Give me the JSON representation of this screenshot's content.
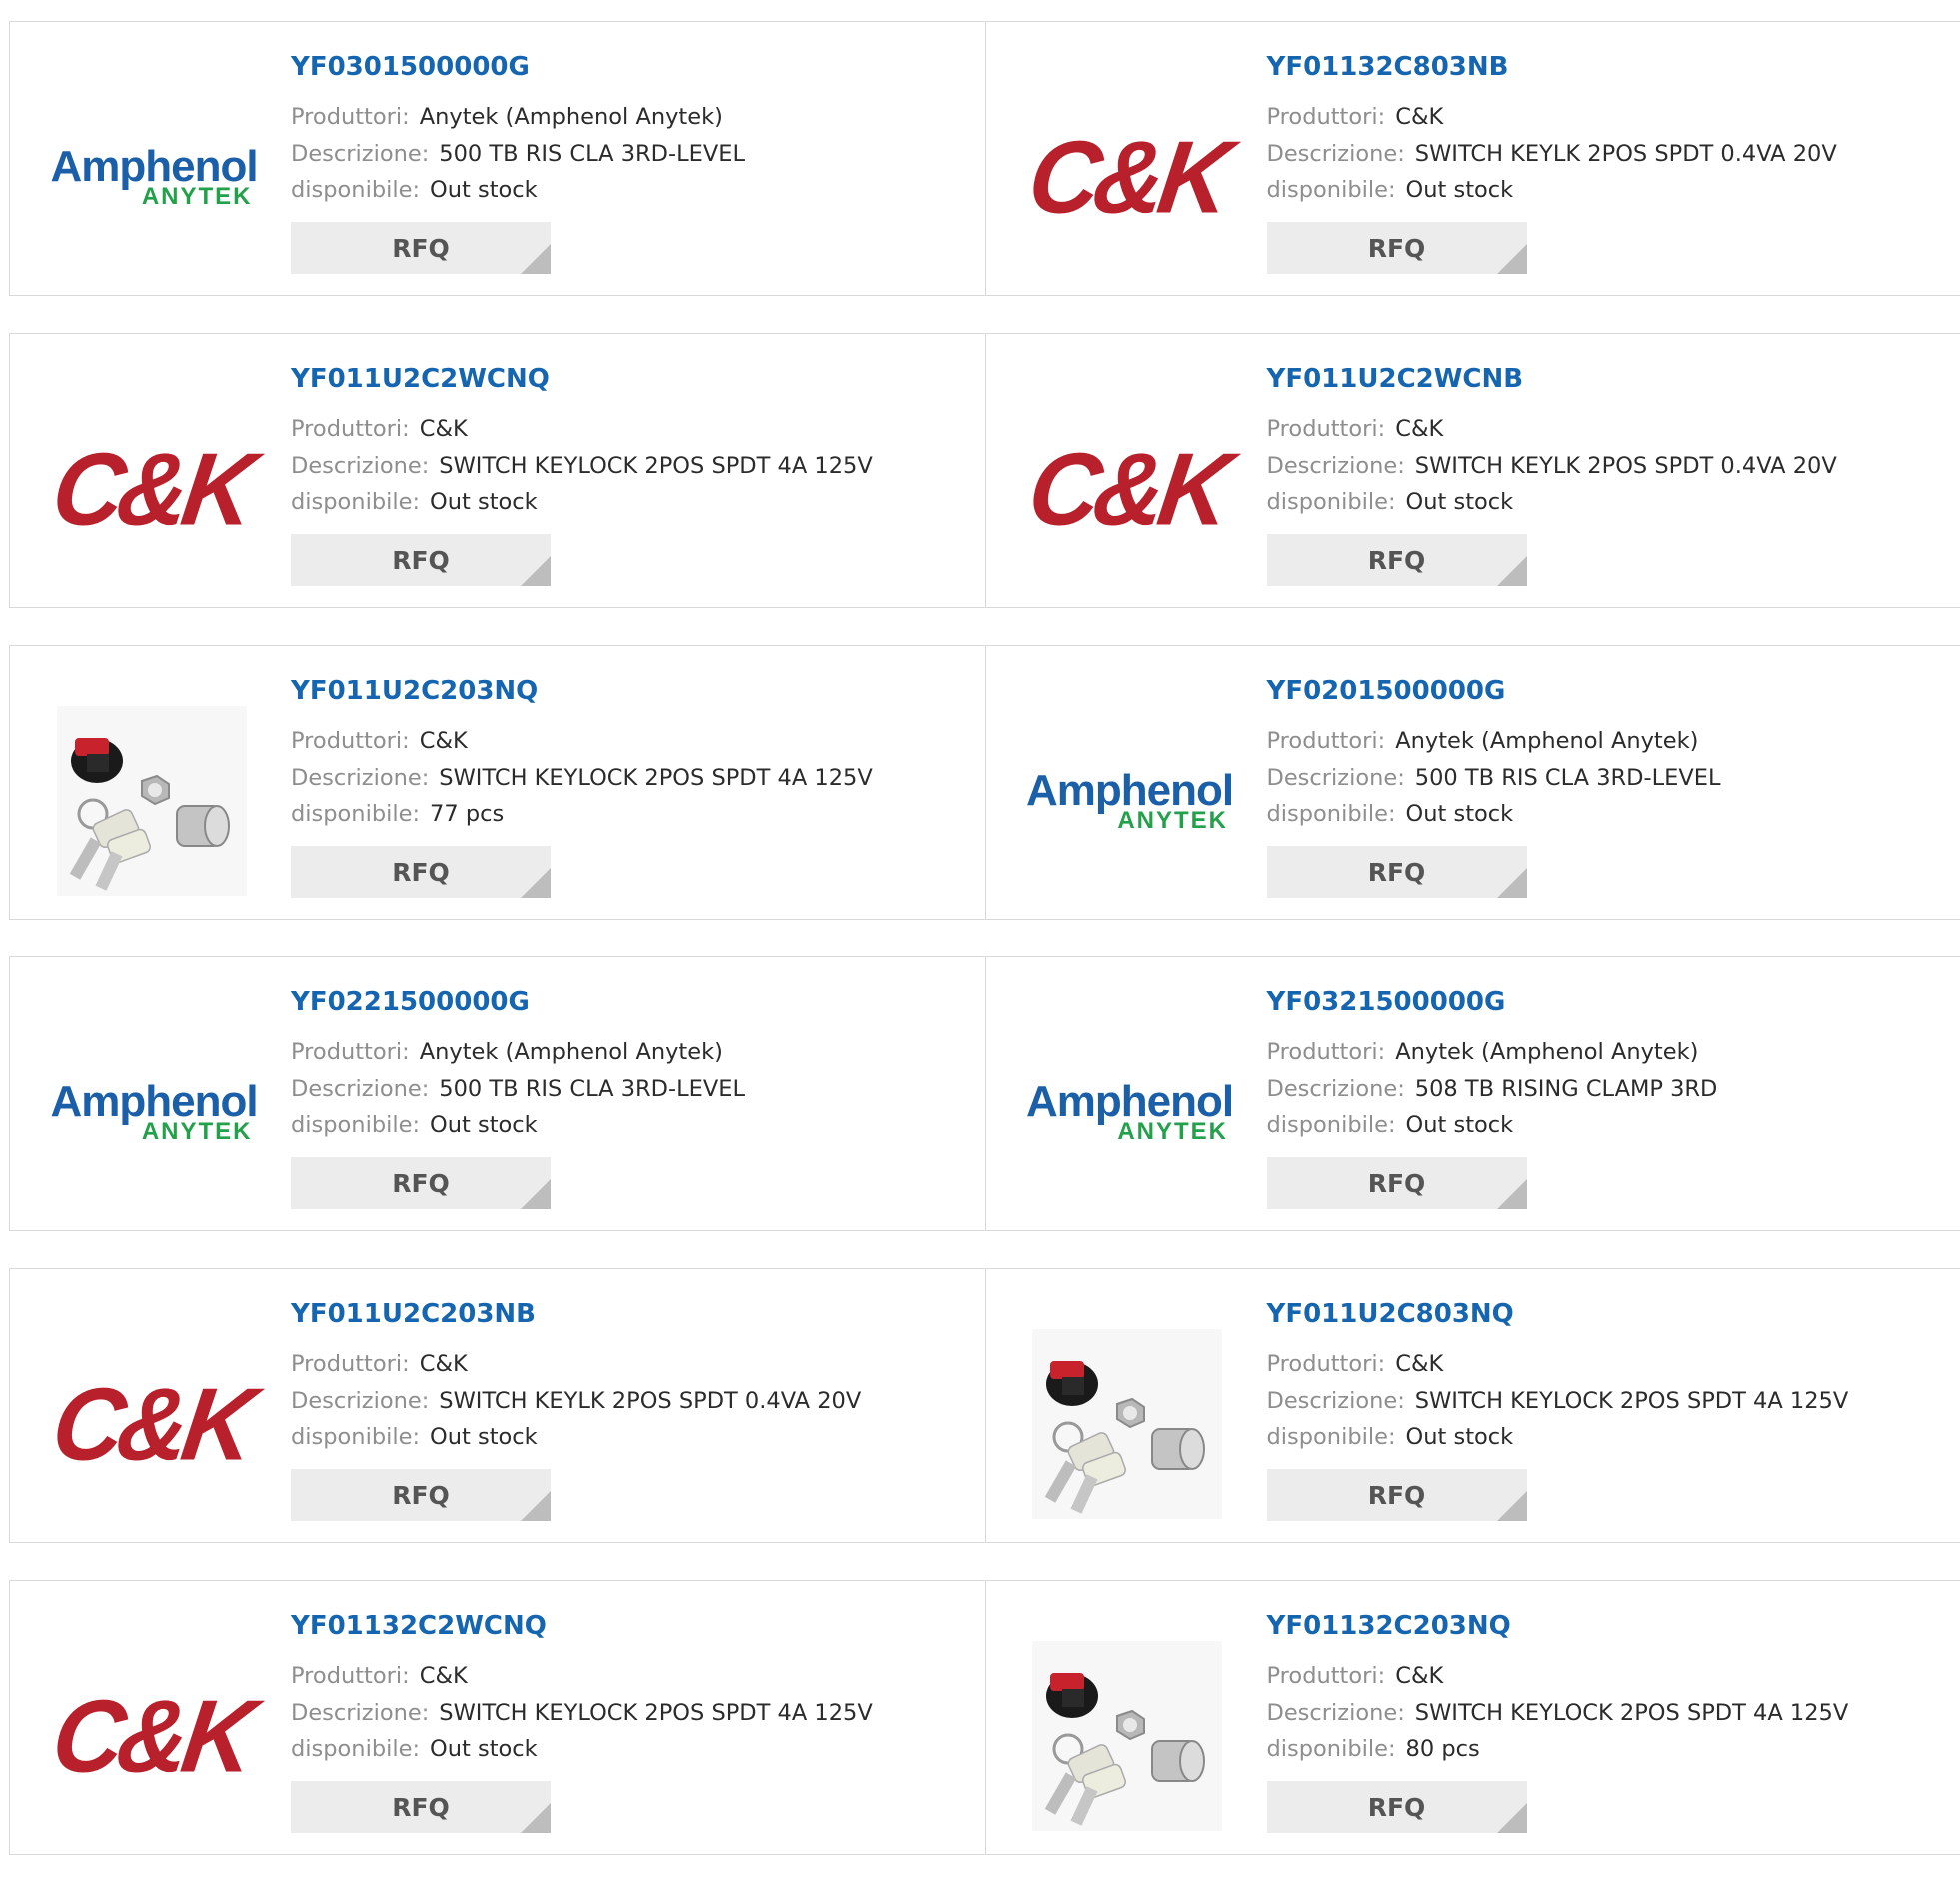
{
  "labels": {
    "manufacturer": "Produttori:",
    "description": "Descrizione:",
    "availability": "disponibile:",
    "rfq": "RFQ"
  },
  "logos": {
    "amphenol_main": "Amphenol",
    "amphenol_sub": "ANYTEK",
    "ck": "C&K"
  },
  "colors": {
    "part_link": "#1565b0",
    "rfq_bg": "#ececec",
    "ck_red": "#b8202b",
    "amphenol_blue": "#1a5fa8",
    "anytek_green": "#22a04a"
  },
  "products": [
    {
      "part": "YF0301500000G",
      "manufacturer": "Anytek (Amphenol Anytek)",
      "description": "500 TB RIS CLA 3RD-LEVEL",
      "availability": "Out stock",
      "image": "amphenol-anytek-logo"
    },
    {
      "part": "YF01132C803NB",
      "manufacturer": "C&K",
      "description": "SWITCH KEYLK 2POS SPDT 0.4VA 20V",
      "availability": "Out stock",
      "image": "ck-logo"
    },
    {
      "part": "YF011U2C2WCNQ",
      "manufacturer": "C&K",
      "description": "SWITCH KEYLOCK 2POS SPDT 4A 125V",
      "availability": "Out stock",
      "image": "ck-logo"
    },
    {
      "part": "YF011U2C2WCNB",
      "manufacturer": "C&K",
      "description": "SWITCH KEYLK 2POS SPDT 0.4VA 20V",
      "availability": "Out stock",
      "image": "ck-logo"
    },
    {
      "part": "YF011U2C203NQ",
      "manufacturer": "C&K",
      "description": "SWITCH KEYLOCK 2POS SPDT 4A 125V",
      "availability": "77 pcs",
      "image": "keylock-switch-photo"
    },
    {
      "part": "YF0201500000G",
      "manufacturer": "Anytek (Amphenol Anytek)",
      "description": "500 TB RIS CLA 3RD-LEVEL",
      "availability": "Out stock",
      "image": "amphenol-anytek-logo"
    },
    {
      "part": "YF0221500000G",
      "manufacturer": "Anytek (Amphenol Anytek)",
      "description": "500 TB RIS CLA 3RD-LEVEL",
      "availability": "Out stock",
      "image": "amphenol-anytek-logo"
    },
    {
      "part": "YF0321500000G",
      "manufacturer": "Anytek (Amphenol Anytek)",
      "description": "508 TB RISING CLAMP 3RD",
      "availability": "Out stock",
      "image": "amphenol-anytek-logo"
    },
    {
      "part": "YF011U2C203NB",
      "manufacturer": "C&K",
      "description": "SWITCH KEYLK 2POS SPDT 0.4VA 20V",
      "availability": "Out stock",
      "image": "ck-logo"
    },
    {
      "part": "YF011U2C803NQ",
      "manufacturer": "C&K",
      "description": "SWITCH KEYLOCK 2POS SPDT 4A 125V",
      "availability": "Out stock",
      "image": "keylock-switch-photo"
    },
    {
      "part": "YF01132C2WCNQ",
      "manufacturer": "C&K",
      "description": "SWITCH KEYLOCK 2POS SPDT 4A 125V",
      "availability": "Out stock",
      "image": "ck-logo"
    },
    {
      "part": "YF01132C203NQ",
      "manufacturer": "C&K",
      "description": "SWITCH KEYLOCK 2POS SPDT 4A 125V",
      "availability": "80 pcs",
      "image": "keylock-switch-photo"
    }
  ]
}
